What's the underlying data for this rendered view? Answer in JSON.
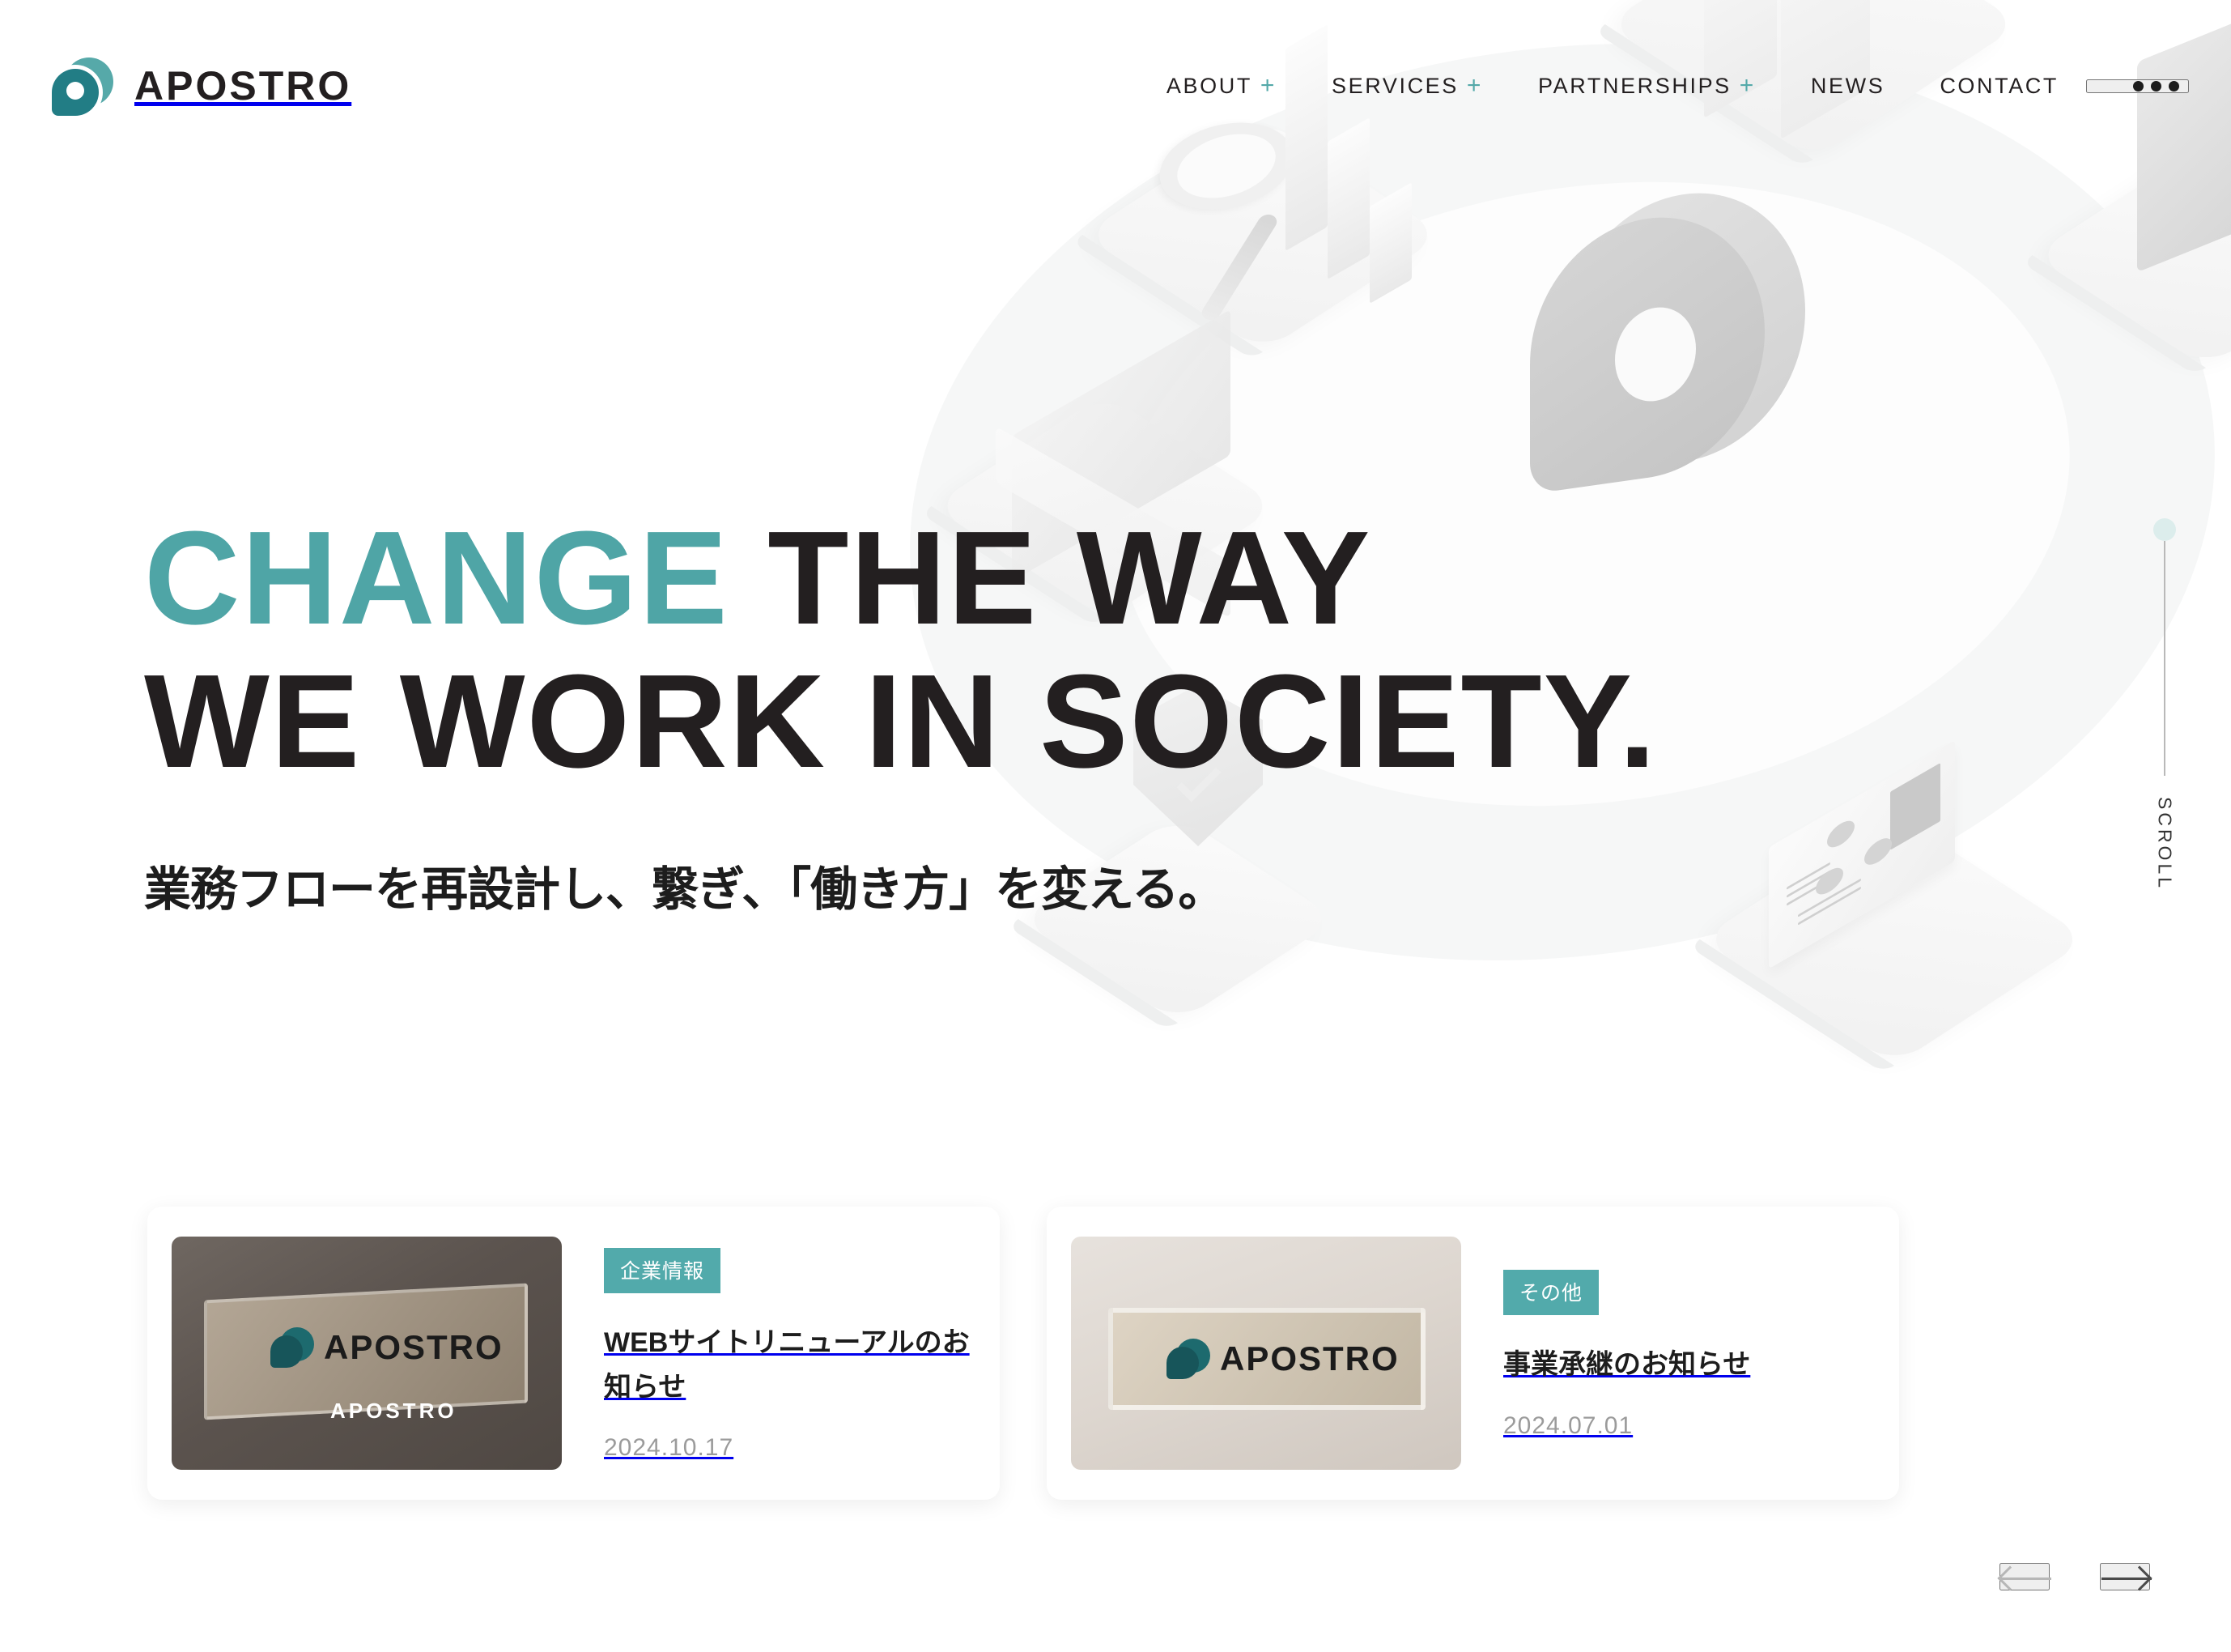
{
  "brand": {
    "name": "APOSTRO",
    "logo_icon": "apostro-logo-mark",
    "accent_color": "#4fa5a6",
    "logo_light_teal": "#56a9a9",
    "logo_dark_teal": "#227d85"
  },
  "nav": {
    "items": [
      {
        "label": "ABOUT",
        "plus": "+",
        "has_plus": true
      },
      {
        "label": "SERVICES",
        "plus": "+",
        "has_plus": true
      },
      {
        "label": "PARTNERSHIPS",
        "plus": "+",
        "has_plus": true
      },
      {
        "label": "NEWS",
        "plus": "",
        "has_plus": false
      },
      {
        "label": "CONTACT",
        "plus": "",
        "has_plus": false
      }
    ],
    "more_icon": "ellipsis-menu-icon"
  },
  "hero": {
    "headline_line1_accent": "CHANGE",
    "headline_line1_rest": " THE WAY",
    "headline_line2": "WE WORK IN SOCIETY.",
    "subheadline": "業務フローを再設計し、繋ぎ、「働き方」を変える。",
    "illustration": "isometric-3d-office-illustration"
  },
  "scroll_indicator": {
    "label": "SCROLL",
    "dot_color": "#dcedec",
    "line_color": "#b9b9b9"
  },
  "news": {
    "cards": [
      {
        "tag": "企業情報",
        "title": "WEBサイトリニューアルのお知らせ",
        "date": "2024.10.17",
        "thumb_alt": "APOSTRO signage dark",
        "thumb_logo_word": "APOSTRO",
        "thumb_caption": "APOSTRO"
      },
      {
        "tag": "その他",
        "title": "事業承継のお知らせ",
        "date": "2024.07.01",
        "thumb_alt": "APOSTRO signage light",
        "thumb_logo_word": "APOSTRO",
        "thumb_caption": ""
      }
    ],
    "tag_color": "#52aaab"
  },
  "carousel": {
    "prev_icon": "arrow-left-icon",
    "next_icon": "arrow-right-icon",
    "prev_enabled": false,
    "next_enabled": true
  }
}
